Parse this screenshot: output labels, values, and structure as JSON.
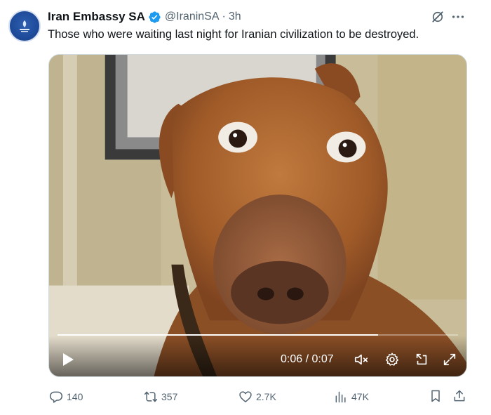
{
  "tweet": {
    "author_name": "Iran Embassy SA",
    "handle": "@IraninSA",
    "separator": "·",
    "time": "3h",
    "text": "Those who were waiting last night for Iranian civilization to be destroyed."
  },
  "video": {
    "current_time": "0:06 / 0:07",
    "progress_fraction": 0.8
  },
  "actions": {
    "replies": "140",
    "reposts": "357",
    "likes": "2.7K",
    "views": "47K"
  },
  "colors": {
    "verified_blue": "#1d9bf0",
    "secondary_text": "#536471",
    "primary_text": "#0f1419"
  },
  "icons": {
    "avatar": "embassy-emblem",
    "verified": "verified-badge-icon",
    "grok": "grok-icon",
    "more": "more-icon",
    "play": "play-icon",
    "mute": "muted-volume-icon",
    "settings": "gear-icon",
    "pip": "picture-in-picture-icon",
    "fullscreen": "expand-icon",
    "reply": "reply-icon",
    "repost": "repost-icon",
    "like": "heart-icon",
    "views": "views-chart-icon",
    "bookmark": "bookmark-icon",
    "share": "share-icon"
  }
}
